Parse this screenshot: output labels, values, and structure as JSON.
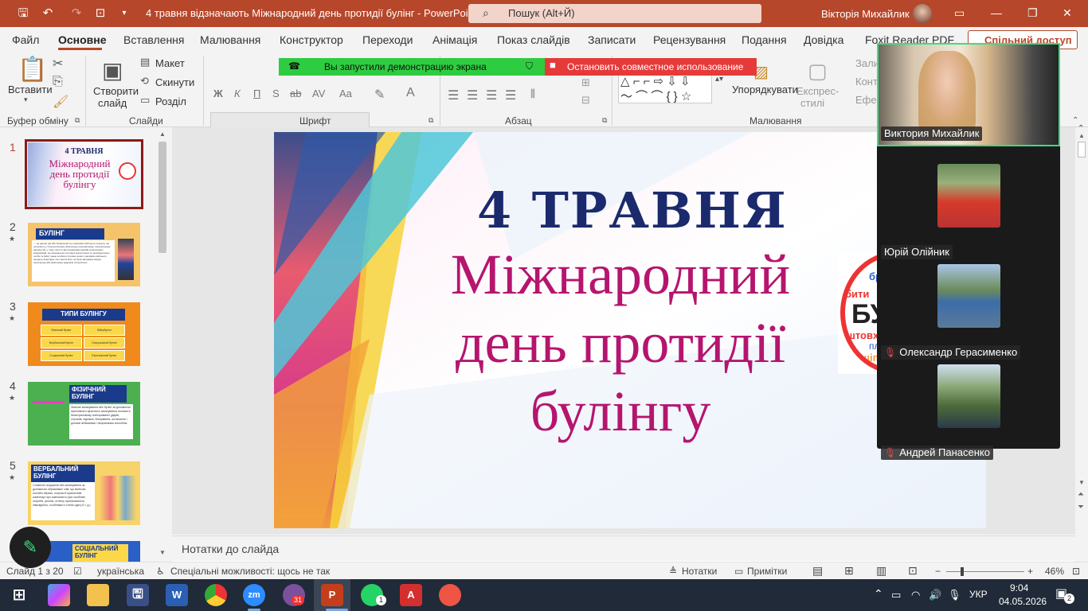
{
  "titlebar": {
    "document_title": "4 травня відзначають Міжнародний день протидії булінг  -  PowerPoint",
    "search_placeholder": "Пошук (Alt+Й)",
    "user_name": "Вікторія Михайлик"
  },
  "menu": {
    "tabs": [
      "Файл",
      "Основне",
      "Вставлення",
      "Малювання",
      "Конструктор",
      "Переходи",
      "Анімація",
      "Показ слайдів",
      "Записати",
      "Рецензування",
      "Подання",
      "Довідка",
      "Foxit Reader PDF"
    ],
    "active_tab": "Основне",
    "share_label": "Спільний доступ"
  },
  "ribbon": {
    "clipboard": {
      "paste": "Вставити",
      "group": "Буфер обміну"
    },
    "slides": {
      "new_slide_1": "Створити",
      "new_slide_2": "слайд",
      "layout": "Макет",
      "reset": "Скинути",
      "section": "Розділ",
      "group": "Слайди"
    },
    "font": {
      "bold": "Ж",
      "italic": "К",
      "underline": "П",
      "shadow": "S",
      "strike": "ab",
      "spacing": "AV",
      "case": "Aa",
      "group": "Шрифт"
    },
    "paragraph": {
      "group": "Абзац"
    },
    "drawing": {
      "arrange": "Упорядкувати",
      "quick_styles_1": "Експрес-",
      "quick_styles_2": "стилі",
      "fill": "Зали",
      "outline": "Конт",
      "effects": "Ефек",
      "group": "Малювання"
    }
  },
  "share_banners": {
    "started": "Вы запустили демонстрацию экрана",
    "stop": "Остановить совместное использование"
  },
  "thumbnails": [
    {
      "num": "1",
      "title_1": "4 ТРАВНЯ",
      "title_2": "Міжнародний",
      "title_3": "день протидії",
      "title_4": "булінгу"
    },
    {
      "num": "2",
      "title": "БУЛІНГ",
      "body": "— це діяння (дії або бездіяльність) учасників освітнього процесу, які полягають у психологічному, фізичному, економічному, сексуальному насильстві, у тому числі із застосуванням засобів електронних комунікацій, що вчиняються стосовно малолітньої чи неповнолітньої особи та (або) такою особою стосовно інших учасників освітнього процесу, внаслідок чого могла бути чи була заподіяна шкода психічному або фізичному здоров'ю потерпілого."
    },
    {
      "num": "3",
      "title": "ТИПИ БУЛІНГУ",
      "cells": [
        "Фізичний булінг",
        "Кібербулінг",
        "Вербальний булінг",
        "Сексуальний булінг",
        "Соціальний булінг",
        "Економічний булінг"
      ]
    },
    {
      "num": "4",
      "title": "ФІЗИЧНИЙ БУЛІНГ",
      "body": "Фізичне залякування або булінг за допомогою агресивного фізичного залякування полягає в багаторазовому повторюванні ударів, стусанів, підніжок, блокування, штовхання і дотиків небажаним і неприємним способом"
    },
    {
      "num": "5",
      "title": "ВЕРБАЛЬНИЙ БУЛІНГ",
      "body": "Словесне знущання або залякування за допомогою образливих слів, що включає постійні образи, погрози й принизливі коментарі про зовнішність (про особливі потреби, релігію, етнічну приналежність, інвалідність, особливості стилю одягу й т. д.)"
    },
    {
      "num": "6",
      "title": "СОЦІАЛЬНИЙ БУЛІНГ"
    }
  ],
  "slide": {
    "line1": "4 ТРАВНЯ",
    "line2": "Міжнародний",
    "line3": "день протидії",
    "line4": "булінгу",
    "logo_lines": [
      "бре",
      "бити",
      "БУ",
      "штовха",
      "плі",
      "щіпа"
    ]
  },
  "notes_placeholder": "Нотатки до слайда",
  "statusbar": {
    "slide_count": "Слайд 1 з 20",
    "language": "українська",
    "accessibility": "Спеціальні можливості: щось не так",
    "notes": "Нотатки",
    "comments": "Примітки",
    "zoom": "46%",
    "zoom_minus": "−",
    "zoom_plus": "+"
  },
  "video_participants": [
    {
      "name": "Виктория Михайлик",
      "muted": false
    },
    {
      "name": "Юрій Олійник",
      "muted": false
    },
    {
      "name": "Олександр Герасименко",
      "muted": true
    },
    {
      "name": "Андрей Панасенко",
      "muted": true
    }
  ],
  "taskbar": {
    "lang": "УКР",
    "time": "9:04",
    "date": "04.05.2026",
    "viber_badge": "31",
    "whatsapp_badge": "1",
    "notifications": "2",
    "zoom_label": "zm"
  },
  "colors": {
    "accent": "#b7472a",
    "slide_title_navy": "#1a2a6c",
    "slide_text_magenta": "#b5156e",
    "banner_green": "#2ecc40",
    "banner_red": "#e63a3a"
  }
}
